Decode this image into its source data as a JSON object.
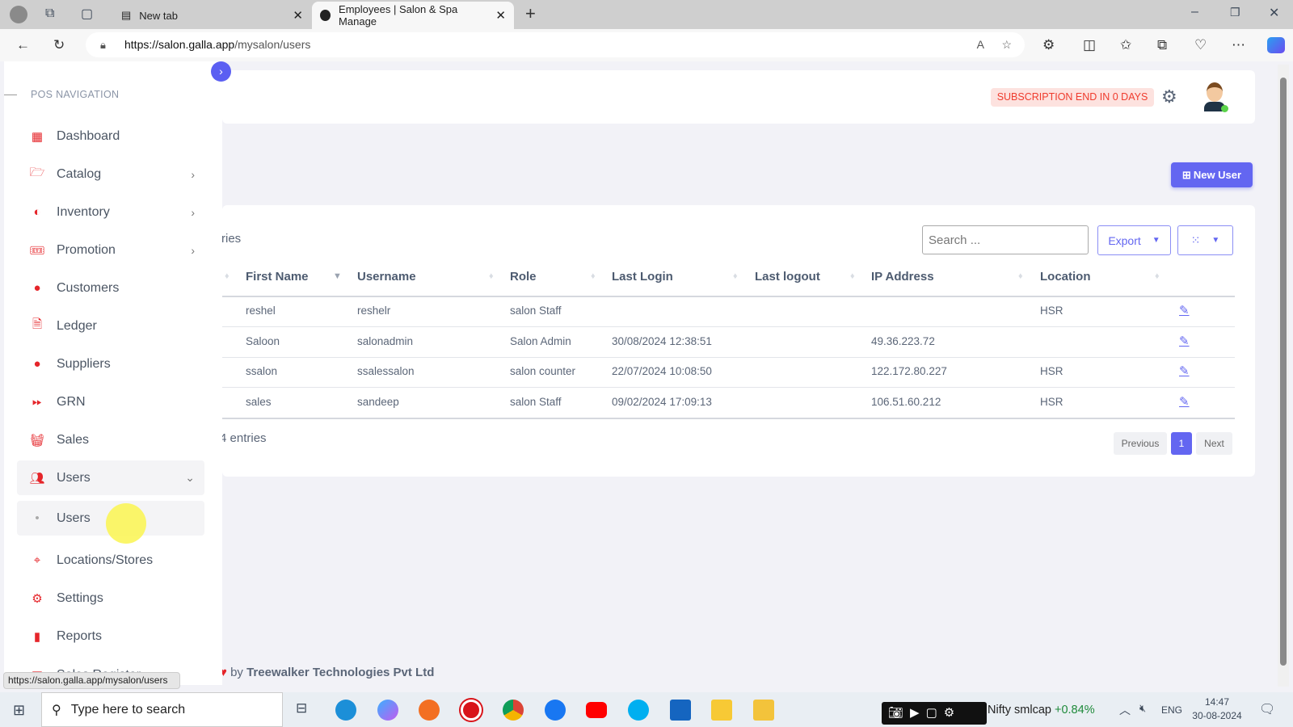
{
  "browser": {
    "tabs": [
      {
        "label": "New tab"
      },
      {
        "label": "Employees | Salon & Spa Manage"
      }
    ],
    "url_host": "https://salon.galla.app",
    "url_path": "/mysalon/users",
    "status_url": "https://salon.galla.app/mysalon/users"
  },
  "sidebar": {
    "heading": "POS NAVIGATION",
    "items": [
      {
        "label": "Dashboard",
        "icon": "dashboard-icon"
      },
      {
        "label": "Catalog",
        "icon": "folder-icon"
      },
      {
        "label": "Inventory",
        "icon": "inventory-icon"
      },
      {
        "label": "Promotion",
        "icon": "ticket-icon"
      },
      {
        "label": "Customers",
        "icon": "user-icon"
      },
      {
        "label": "Ledger",
        "icon": "document-icon"
      },
      {
        "label": "Suppliers",
        "icon": "user-icon"
      },
      {
        "label": "GRN",
        "icon": "forward-icon"
      },
      {
        "label": "Sales",
        "icon": "basket-icon"
      },
      {
        "label": "Users",
        "icon": "users-icon"
      },
      {
        "label": "Users"
      },
      {
        "label": "Locations/Stores",
        "icon": "pin-icon"
      },
      {
        "label": "Settings",
        "icon": "gear-icon"
      },
      {
        "label": "Reports",
        "icon": "report-icon"
      },
      {
        "label": "Sales Register",
        "icon": "register-icon"
      }
    ]
  },
  "header": {
    "subscription": "SUBSCRIPTION END IN 0 DAYS"
  },
  "toolbar": {
    "new_user": "New User",
    "search_placeholder": "Search ...",
    "export": "Export"
  },
  "table": {
    "length_text": "ries",
    "columns": [
      "First Name",
      "Username",
      "Role",
      "Last Login",
      "Last logout",
      "IP Address",
      "Location"
    ],
    "rows": [
      [
        "reshel",
        "reshelr",
        "salon Staff",
        "",
        "",
        "",
        "HSR"
      ],
      [
        "Saloon",
        "salonadmin",
        "Salon Admin",
        "30/08/2024 12:38:51",
        "",
        "49.36.223.72",
        ""
      ],
      [
        "ssalon",
        "ssalessalon",
        "salon counter",
        "22/07/2024 10:08:50",
        "",
        "122.172.80.227",
        "HSR"
      ],
      [
        "sales",
        "sandeep",
        "salon Staff",
        "09/02/2024 17:09:13",
        "",
        "106.51.60.212",
        "HSR"
      ]
    ],
    "info": "4 entries",
    "pagination": {
      "previous": "Previous",
      "current": "1",
      "next": "Next"
    }
  },
  "footer": {
    "by": "by",
    "company": "Treewalker Technologies Pvt Ltd"
  },
  "taskbar": {
    "search_placeholder": "Type here to search",
    "stock_name": "Nifty smlcap",
    "stock_change": "+0.84%",
    "lang": "ENG",
    "time": "14:47",
    "date": "30-08-2024"
  },
  "colors": {
    "accent": "#6366f1",
    "sidebar_icon": "#e5252a",
    "badge_text": "#ef3b2d",
    "badge_bg": "#fde2df"
  }
}
